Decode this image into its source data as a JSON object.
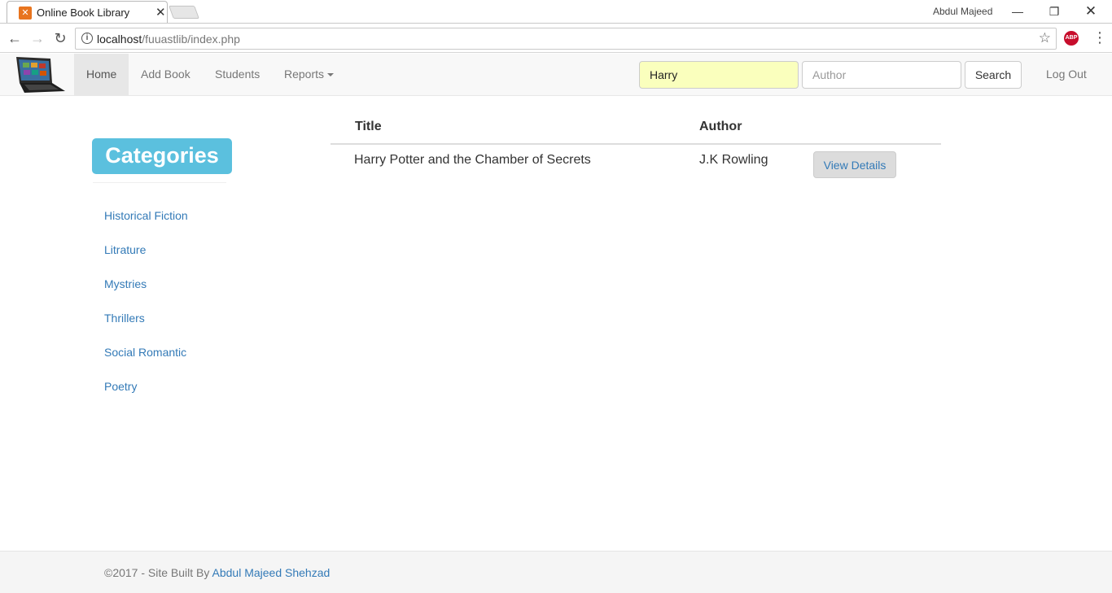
{
  "browser": {
    "tab_title": "Online Book Library",
    "user": "Abdul Majeed",
    "url_host": "localhost",
    "url_path": "/fuuastlib/index.php",
    "abp_label": "ABP"
  },
  "navbar": {
    "items": [
      {
        "label": "Home",
        "active": true
      },
      {
        "label": "Add Book"
      },
      {
        "label": "Students"
      },
      {
        "label": "Reports"
      }
    ],
    "title_input_value": "Harry",
    "author_placeholder": "Author",
    "search_label": "Search",
    "logout_label": "Log Out"
  },
  "sidebar": {
    "heading": "Categories",
    "items": [
      {
        "label": "Historical Fiction"
      },
      {
        "label": "Litrature"
      },
      {
        "label": "Mystries"
      },
      {
        "label": "Thrillers"
      },
      {
        "label": "Social Romantic"
      },
      {
        "label": "Poetry"
      }
    ]
  },
  "table": {
    "headers": [
      "Title",
      "Author"
    ],
    "rows": [
      {
        "title": "Harry Potter and the Chamber of Secrets",
        "author": "J.K Rowling",
        "action": "View Details"
      }
    ]
  },
  "footer": {
    "prefix": "©2017 - Site Built By ",
    "author_link": "Abdul Majeed Shehzad"
  },
  "colors": {
    "accent": "#337ab7",
    "category_badge": "#5bc0de",
    "autofill": "#faffbd"
  }
}
